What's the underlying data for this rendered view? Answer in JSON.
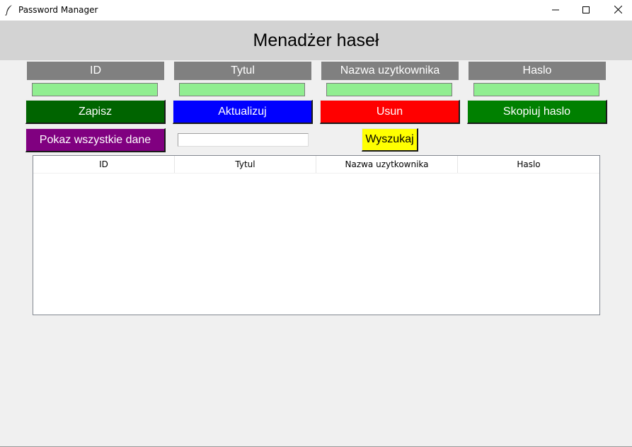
{
  "window": {
    "title": "Password Manager",
    "icon": "feather-icon",
    "controls": [
      "minimize-icon",
      "maximize-icon",
      "close-icon"
    ]
  },
  "header": {
    "title": "Menadżer haseł"
  },
  "fields": [
    {
      "label": "ID",
      "value": ""
    },
    {
      "label": "Tytul",
      "value": ""
    },
    {
      "label": "Nazwa uzytkownika",
      "value": ""
    },
    {
      "label": "Haslo",
      "value": ""
    }
  ],
  "buttons": {
    "save": "Zapisz",
    "update": "Aktualizuj",
    "delete": "Usun",
    "copy_password": "Skopiuj haslo",
    "show_all": "Pokaz wszystkie dane",
    "search": "Wyszukaj"
  },
  "search": {
    "value": ""
  },
  "table": {
    "columns": [
      "ID",
      "Tytul",
      "Nazwa uzytkownika",
      "Haslo"
    ],
    "rows": []
  },
  "colors": {
    "header_bg": "#d3d3d3",
    "label_bg": "#808080",
    "entry_bg": "#90ee90",
    "save_bg": "#006400",
    "update_bg": "#0000ff",
    "delete_bg": "#ff0000",
    "copy_bg": "#008000",
    "show_all_bg": "#800080",
    "search_bg": "#ffff00"
  }
}
